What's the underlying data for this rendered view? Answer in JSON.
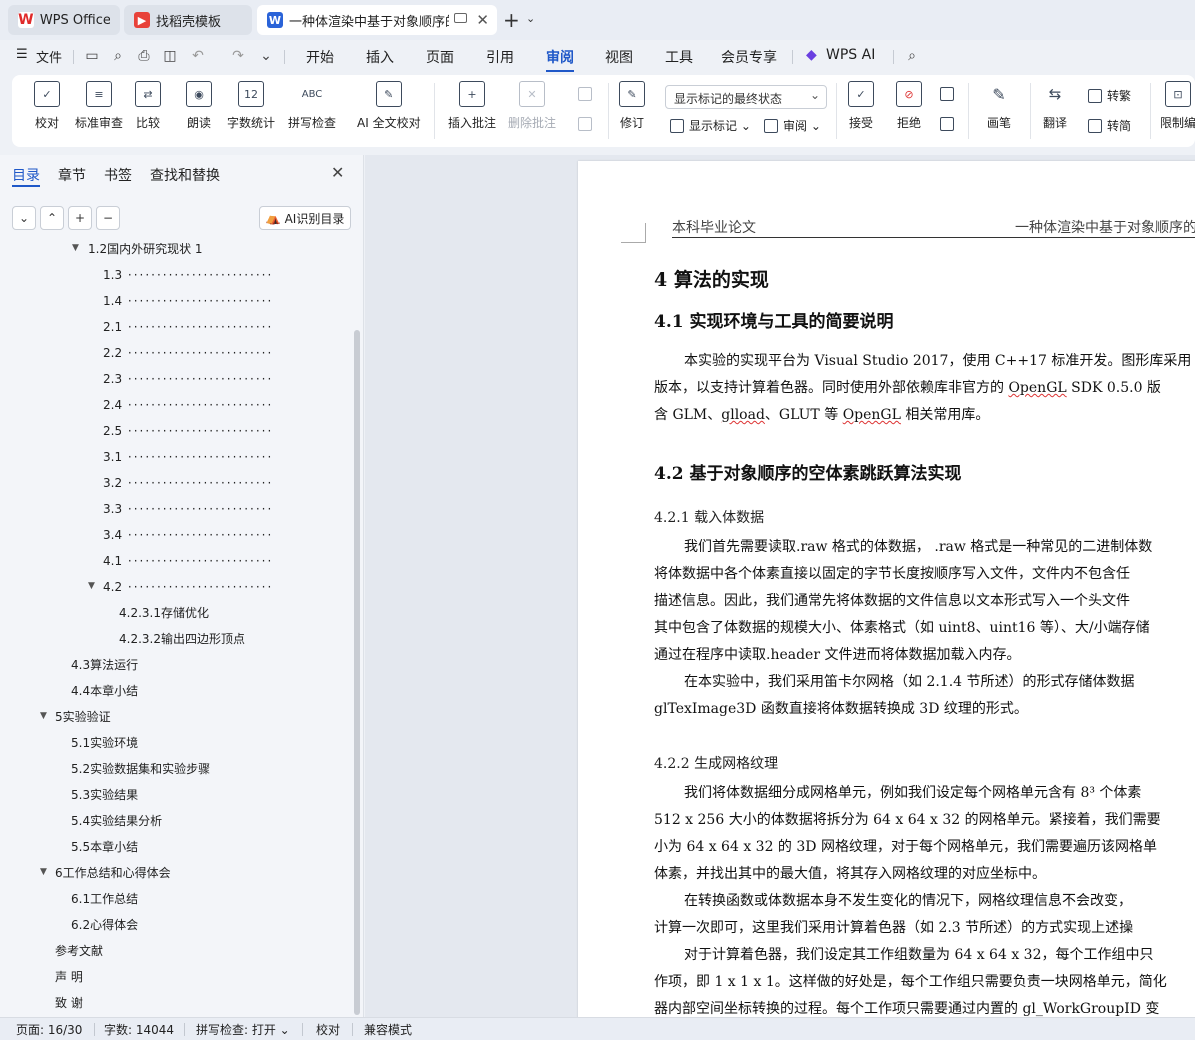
{
  "tabs": [
    {
      "label": "WPS Office",
      "icon": "wps-logo-icon"
    },
    {
      "label": "找稻壳模板",
      "icon": "docer-icon"
    },
    {
      "label": "一种体渲染中基于对象顺序的",
      "icon": "word-doc-icon"
    }
  ],
  "menubar": {
    "file": "文件",
    "items": [
      "开始",
      "插入",
      "页面",
      "引用",
      "审阅",
      "视图",
      "工具",
      "会员专享"
    ],
    "active": "审阅",
    "wps_ai": "WPS AI"
  },
  "ribbon": {
    "proofread": "校对",
    "standard_review": "标准审查",
    "compare": "比较",
    "read_aloud": "朗读",
    "word_count": "字数统计",
    "spell_check": "拼写检查",
    "ai_proofread": "AI 全文校对",
    "insert_comment": "插入批注",
    "delete_comment": "删除批注",
    "markup_dropdown": "显示标记的最终状态",
    "track_changes": "修订",
    "show_markup": "显示标记",
    "review": "审阅",
    "accept": "接受",
    "reject": "拒绝",
    "pen": "画笔",
    "translate": "翻译",
    "to_traditional": "转繁",
    "to_simplified": "转简",
    "restrict_edit": "限制编"
  },
  "panel": {
    "tabs": [
      "目录",
      "章节",
      "书签",
      "查找和替换"
    ],
    "ai_toc": "AI识别目录",
    "toc": [
      {
        "label": "1.2国内外研究现状 1",
        "level": 2,
        "arrow": true
      },
      {
        "label": "1.3",
        "level": 3,
        "dots": true
      },
      {
        "label": "1.4",
        "level": 3,
        "dots": true
      },
      {
        "label": "2.1",
        "level": 3,
        "dots": true
      },
      {
        "label": "2.2",
        "level": 3,
        "dots": true
      },
      {
        "label": "2.3",
        "level": 3,
        "dots": true
      },
      {
        "label": "2.4",
        "level": 3,
        "dots": true
      },
      {
        "label": "2.5",
        "level": 3,
        "dots": true
      },
      {
        "label": "3.1",
        "level": 3,
        "dots": true
      },
      {
        "label": "3.2",
        "level": 3,
        "dots": true
      },
      {
        "label": "3.3",
        "level": 3,
        "dots": true
      },
      {
        "label": "3.4",
        "level": 3,
        "dots": true
      },
      {
        "label": "4.1",
        "level": 3,
        "dots": true
      },
      {
        "label": "4.2",
        "level": 3,
        "dots": true,
        "arrow": true
      },
      {
        "label": "4.2.3.1存储优化",
        "level": 4
      },
      {
        "label": "4.2.3.2输出四边形顶点",
        "level": 4
      },
      {
        "label": "4.3算法运行",
        "level": 2
      },
      {
        "label": "4.4本章小结",
        "level": 2
      },
      {
        "label": "5实验验证",
        "level": 1,
        "arrow": true
      },
      {
        "label": "5.1实验环境",
        "level": 2
      },
      {
        "label": "5.2实验数据集和实验步骤",
        "level": 2
      },
      {
        "label": "5.3实验结果",
        "level": 2
      },
      {
        "label": "5.4实验结果分析",
        "level": 2
      },
      {
        "label": "5.5本章小结",
        "level": 2
      },
      {
        "label": "6工作总结和心得体会",
        "level": 1,
        "arrow": true
      },
      {
        "label": "6.1工作总结",
        "level": 2
      },
      {
        "label": "6.2心得体会",
        "level": 2
      },
      {
        "label": "参考文献",
        "level": 1
      },
      {
        "label": "声 明",
        "level": 1
      },
      {
        "label": "致 谢",
        "level": 1
      }
    ]
  },
  "doc": {
    "header_left": "本科毕业论文",
    "header_right": "一种体渲染中基于对象顺序的",
    "h_chapter": "4   算法的实现",
    "h_41": "4.1    实现环境与工具的简要说明",
    "p41_1a": "本实验的实现平台为  Visual Studio 2017，使用 C++17 标准开发。图形库采用",
    "p41_2a": "版本，以支持计算着色器。同时使用外部依赖库非官方的 ",
    "p41_2b": "OpenGL",
    "p41_2c": " SDK 0.5.0 版",
    "p41_3a": "含 GLM、",
    "p41_3b": "glload",
    "p41_3c": "、GLUT 等 ",
    "p41_3d": "OpenGL",
    "p41_3e": " 相关常用库。",
    "h_42": "4.2    基于对象顺序的空体素跳跃算法实现",
    "h_421": "4.2.1    载入体数据",
    "p421": [
      "我们首先需要读取.raw 格式的体数据， .raw 格式是一种常见的二进制体数",
      "将体数据中各个体素直接以固定的字节长度按顺序写入文件，文件内不包含任",
      "描述信息。因此，我们通常先将体数据的文件信息以文本形式写入一个头文件",
      "其中包含了体数据的规模大小、体素格式（如 uint8、uint16 等）、大/小端存储",
      "通过在程序中读取.header 文件进而将体数据加载入内存。"
    ],
    "p421b": [
      "在本实验中，我们采用笛卡尔网格（如  2.1.4 节所述）的形式存储体数据",
      "glTexImage3D 函数直接将体数据转换成  3D 纹理的形式。"
    ],
    "h_422": "4.2.2    生成网格纹理",
    "p422": [
      "我们将体数据细分成网格单元，例如我们设定每个网格单元含有  8³ 个体素",
      "512 x 256 大小的体数据将拆分为  64 x 64 x 32 的网格单元。紧接着，我们需要",
      "小为  64 x 64 x 32 的 3D 网格纹理，对于每个网格单元，我们需要遍历该网格单",
      "体素，并找出其中的最大值，将其存入网格纹理的对应坐标中。"
    ],
    "p422b": [
      "在转换函数或体数据本身不发生变化的情况下，网格纹理信息不会改变，",
      "计算一次即可，这里我们采用计算着色器（如  2.3 节所述）的方式实现上述操"
    ],
    "p422c": [
      "对于计算着色器，我们设定其工作组数量为  64 x 64 x 32，每个工作组中只",
      "作项，即 1 x 1 x 1。这样做的好处是，每个工作组只需要负责一块网格单元，简化",
      "器内部空间坐标转换的过程。每个工作项只需要通过内置的  gl_WorkGroupID 变"
    ]
  },
  "status": {
    "page": "页面: 16/30",
    "words": "字数: 14044",
    "spell": "拼写检查: 打开",
    "proof": "校对",
    "compat": "兼容模式"
  }
}
